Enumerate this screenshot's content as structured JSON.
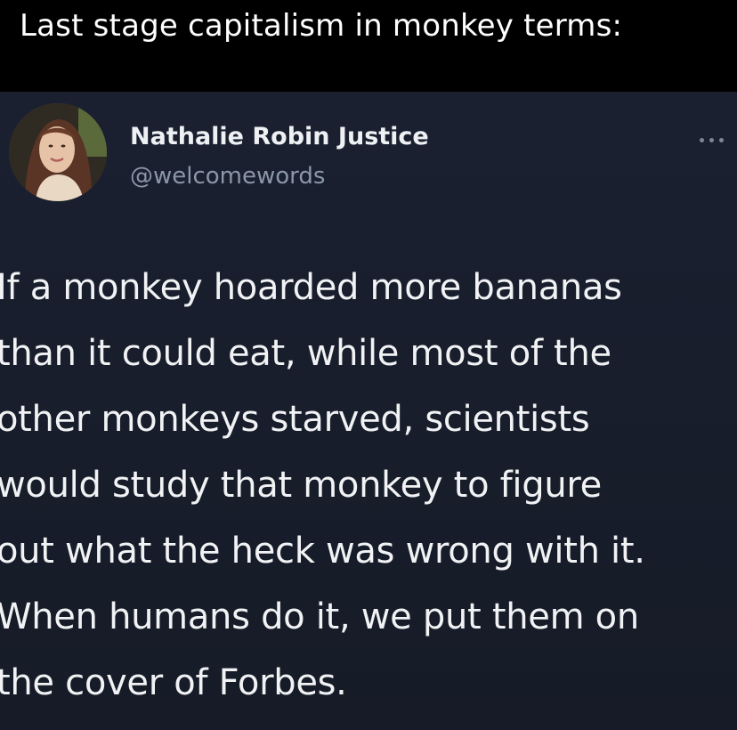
{
  "caption": {
    "text": "Last stage capitalism in monkey terms:"
  },
  "tweet": {
    "author": {
      "name": "Nathalie Robin Justice",
      "handle": "@welcomewords"
    },
    "more_icon": "more-horizontal-icon",
    "body_lines": [
      "If a monkey hoarded more bananas",
      "than it could eat, while most of the",
      "other monkeys starved, scientists",
      "would study that monkey to figure",
      "out what the heck was wrong with it.",
      "When humans do it, we put them on",
      "the cover of Forbes."
    ]
  },
  "colors": {
    "caption_bg": "#000000",
    "tweet_bg": "#171c28",
    "text_primary": "#f1f2f4",
    "text_secondary": "#8b96a6"
  }
}
